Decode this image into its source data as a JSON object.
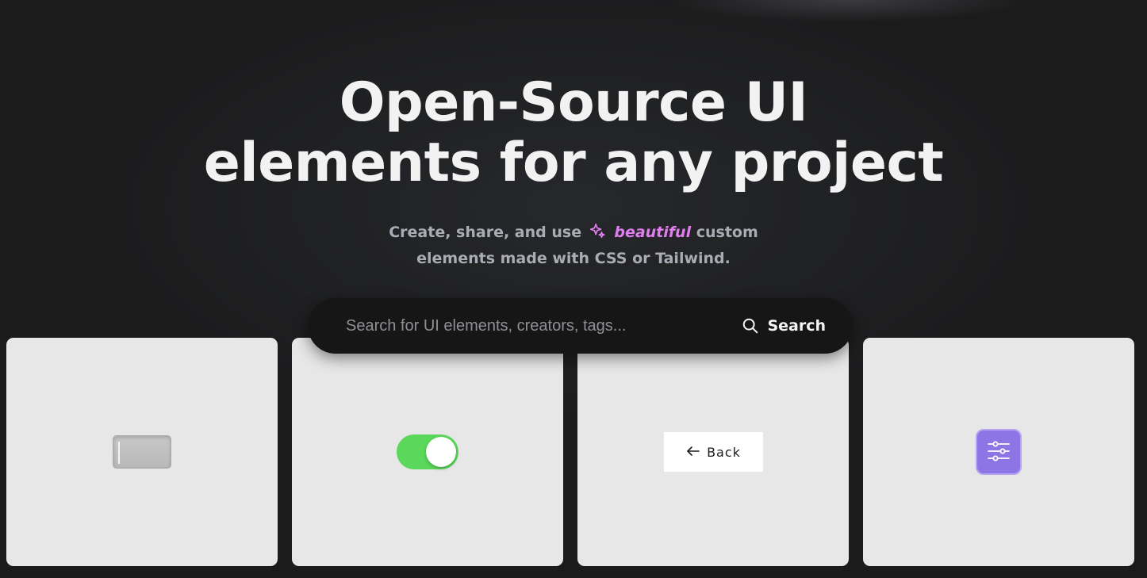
{
  "hero": {
    "title_line1": "Open-Source UI",
    "title_line2": "elements for any project",
    "subtitle_part1": "Create, share, and use",
    "subtitle_accent": "beautiful",
    "subtitle_part2": "custom",
    "subtitle_line2": "elements made with CSS or Tailwind.",
    "accent_color": "#e07ef0"
  },
  "search": {
    "placeholder": "Search for UI elements, creators, tags...",
    "value": "",
    "button_label": "Search",
    "icon": "search-icon"
  },
  "cards": {
    "card1": {
      "preview": "text-input"
    },
    "card2": {
      "preview": "toggle-switch",
      "state": "on",
      "color": "#5bd85b"
    },
    "card3": {
      "preview": "back-button",
      "label": "Back",
      "icon": "arrow-left-icon"
    },
    "card4": {
      "preview": "settings-button",
      "icon": "sliders-icon",
      "color": "#8e75e6"
    }
  }
}
